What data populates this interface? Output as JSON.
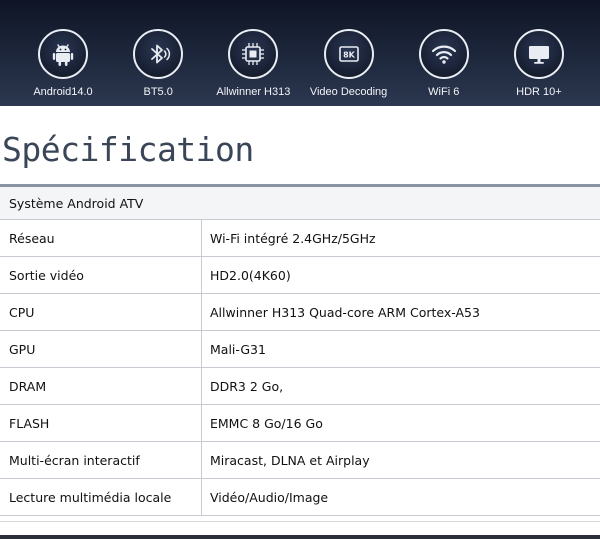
{
  "features": [
    {
      "icon": "android-icon",
      "label": "Android14.0"
    },
    {
      "icon": "bluetooth-icon",
      "label": "BT5.0"
    },
    {
      "icon": "chip-icon",
      "label": "Allwinner H313"
    },
    {
      "icon": "8k-icon",
      "icon_text": "8K",
      "label": "Video Decoding"
    },
    {
      "icon": "wifi-icon",
      "label": "WiFi 6"
    },
    {
      "icon": "monitor-icon",
      "label": "HDR 10+"
    }
  ],
  "title": "Spécification",
  "spec": {
    "header": "Système Android ATV",
    "rows": [
      {
        "key": "Réseau",
        "value": "Wi-Fi intégré 2.4GHz/5GHz"
      },
      {
        "key": "Sortie vidéo",
        "value": "HD2.0(4K60)"
      },
      {
        "key": "CPU",
        "value": "Allwinner H313 Quad-core ARM Cortex-A53"
      },
      {
        "key": "GPU",
        "value": "Mali-G31"
      },
      {
        "key": "DRAM",
        "value": "DDR3 2 Go,"
      },
      {
        "key": "FLASH",
        "value": "EMMC 8 Go/16 Go"
      },
      {
        "key": "Multi-écran interactif",
        "value": "Miracast, DLNA et Airplay"
      },
      {
        "key": "Lecture multimédia locale",
        "value": "Vidéo/Audio/Image"
      }
    ]
  },
  "colors": {
    "banner_bg": "#1b2438",
    "title": "#3a4658",
    "divider": "#8b94a3"
  }
}
